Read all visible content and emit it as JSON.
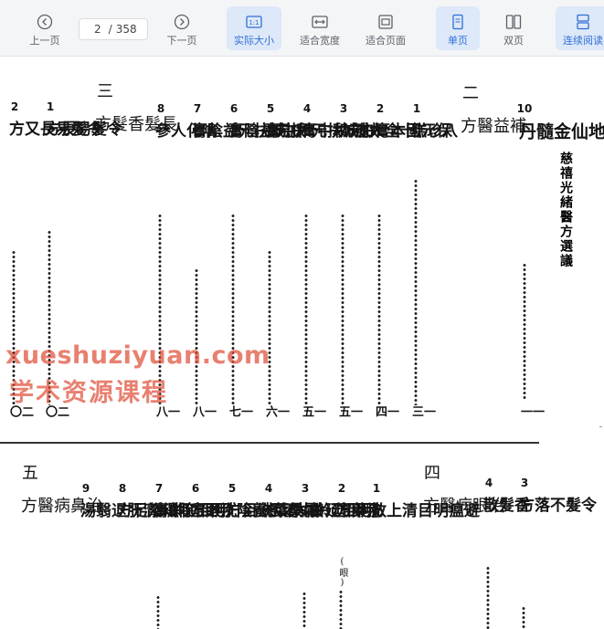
{
  "toolbar": {
    "prev_label": "上一页",
    "page_current": "2",
    "page_total": "358",
    "page_sep": "/",
    "next_label": "下一页",
    "actual_size_label": "实际大小",
    "fit_width_label": "适合宽度",
    "fit_page_label": "适合页面",
    "single_page_label": "单页",
    "double_page_label": "双页",
    "continuous_label": "连续阅读"
  },
  "document": {
    "book_title": "慈禧光緒醫方選議",
    "upper": {
      "entry_10": {
        "num": "10",
        "text": "五芝地仙金髓丹",
        "page": "一一"
      },
      "section_2": {
        "num": "二",
        "text": "補益醫方"
      },
      "entry_1": {
        "num": "1",
        "text": "八珍糕",
        "page": "一三"
      },
      "entry_2": {
        "num": "2",
        "text": "保元固本膏",
        "page": "一四"
      },
      "entry_3": {
        "num": "3",
        "text": "十全大補丸",
        "page": "一五"
      },
      "entry_4": {
        "num": "4",
        "text": "扶元和中膏",
        "page": "一五"
      },
      "entry_5": {
        "num": "5",
        "text": "加減扶元和中膏",
        "page": "一六"
      },
      "entry_6": {
        "num": "6",
        "text": "扶元益陰膏",
        "page": "一七"
      },
      "entry_7": {
        "num": "7",
        "text": "加減扶元益陰膏",
        "page": "一八"
      },
      "entry_8": {
        "num": "8",
        "text": "噙化人參",
        "page": "一八"
      },
      "section_3": {
        "num": "三",
        "text": "長髮香髮方"
      },
      "hair_1": {
        "num": "1",
        "text": "令髮易長方",
        "page": "二〇"
      },
      "hair_2": {
        "num": "2",
        "text": "令髮易長又方",
        "page": "二〇"
      }
    },
    "lower": {
      "hair_3": {
        "num": "3",
        "text": "令髮不落方"
      },
      "hair_4": {
        "num": "4",
        "text": "香髮散"
      },
      "section_4": {
        "num": "四",
        "text": "治眼病醫方"
      },
      "eye_1": {
        "num": "1",
        "text": "避瘟明目清上散"
      },
      "eye_2": {
        "num": "2",
        "text": "洗藥方",
        "note": "(眼)"
      },
      "eye_3": {
        "num": "3",
        "text": "明目延齡丸"
      },
      "eye_4": {
        "num": "4",
        "text": "明目延齡丸又方"
      },
      "eye_5": {
        "num": "5",
        "text": "霜桑葉洗目方"
      },
      "eye_6": {
        "num": "6",
        "text": "清目養陰洗眼方"
      },
      "eye_7": {
        "num": "7",
        "text": "明目延齡膏"
      },
      "eye_8": {
        "num": "8",
        "text": "明目除濕浴足方"
      },
      "eye_9": {
        "num": "9",
        "text": "抑火清肝退翳湯"
      },
      "section_5": {
        "num": "五",
        "text": "治鼻病醫方"
      }
    },
    "watermark": {
      "line1": "xueshuziyuan.com",
      "line2": "学术资源课程"
    }
  },
  "colors": {
    "accent": "#2f6fd6",
    "active_bg": "#dde8f8",
    "watermark": "#e0503a"
  }
}
